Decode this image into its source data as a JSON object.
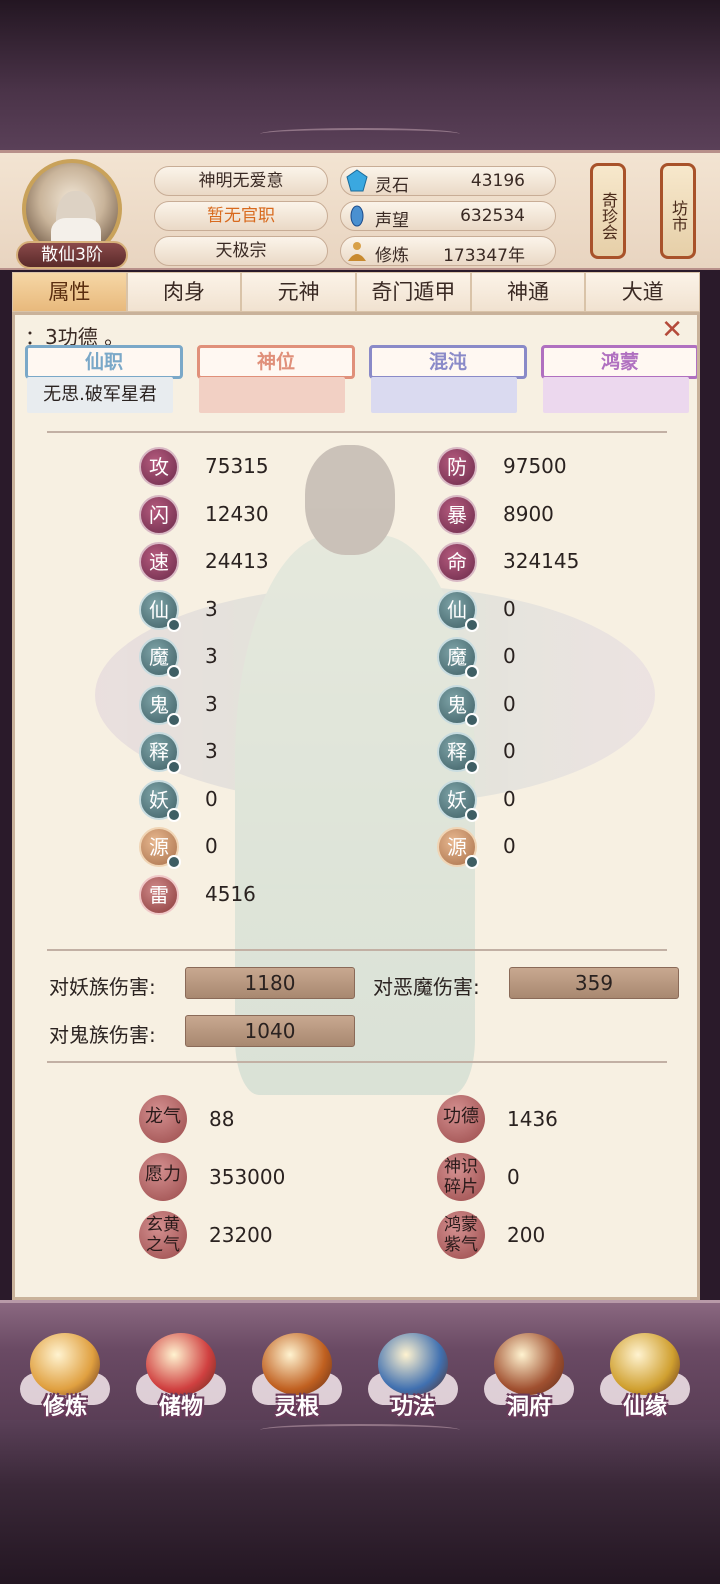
{
  "header": {
    "rank_badge": "散仙3阶",
    "name": "神明无爱意",
    "official_post": "暂无官职",
    "sect": "天极宗",
    "resources": [
      {
        "icon": "spirit-stone-icon",
        "label": "灵石",
        "value": "43196"
      },
      {
        "icon": "reputation-icon",
        "label": "声望",
        "value": "632534"
      },
      {
        "icon": "cultivation-icon",
        "label": "修炼",
        "value": "173347年"
      }
    ],
    "treasure_fair": "奇珍会",
    "market": "坊市"
  },
  "tabs": [
    "属性",
    "肉身",
    "元神",
    "奇门遁甲",
    "神通",
    "大道"
  ],
  "notice": "：3功德 。",
  "ribbons": [
    {
      "label": "仙职",
      "value": "无思.破军星君",
      "color": "#7aa8c8"
    },
    {
      "label": "神位",
      "value": "",
      "color": "#e0907a"
    },
    {
      "label": "混沌",
      "value": "",
      "color": "#8a8ac8"
    },
    {
      "label": "鸿蒙",
      "value": "",
      "color": "#b070c0"
    }
  ],
  "stats_left": [
    {
      "char": "攻",
      "value": "75315",
      "style": "purple",
      "badge": false
    },
    {
      "char": "闪",
      "value": "12430",
      "style": "purple",
      "badge": false
    },
    {
      "char": "速",
      "value": "24413",
      "style": "purple",
      "badge": false
    },
    {
      "char": "仙",
      "value": "3",
      "style": "teal",
      "badge": true
    },
    {
      "char": "魔",
      "value": "3",
      "style": "teal",
      "badge": true
    },
    {
      "char": "鬼",
      "value": "3",
      "style": "teal",
      "badge": true
    },
    {
      "char": "释",
      "value": "3",
      "style": "teal",
      "badge": true
    },
    {
      "char": "妖",
      "value": "0",
      "style": "teal",
      "badge": true
    },
    {
      "char": "源",
      "value": "0",
      "style": "gold",
      "badge": true
    },
    {
      "char": "雷",
      "value": "4516",
      "style": "red",
      "badge": false
    }
  ],
  "stats_right": [
    {
      "char": "防",
      "value": "97500",
      "style": "purple",
      "badge": false
    },
    {
      "char": "暴",
      "value": "8900",
      "style": "purple",
      "badge": false
    },
    {
      "char": "命",
      "value": "324145",
      "style": "purple",
      "badge": false
    },
    {
      "char": "仙",
      "value": "0",
      "style": "teal",
      "badge": true
    },
    {
      "char": "魔",
      "value": "0",
      "style": "teal",
      "badge": true
    },
    {
      "char": "鬼",
      "value": "0",
      "style": "teal",
      "badge": true
    },
    {
      "char": "释",
      "value": "0",
      "style": "teal",
      "badge": true
    },
    {
      "char": "妖",
      "value": "0",
      "style": "teal",
      "badge": true
    },
    {
      "char": "源",
      "value": "0",
      "style": "gold",
      "badge": true
    }
  ],
  "damage": {
    "yao_label": "对妖族伤害:",
    "yao_value": "1180",
    "demon_label": "对恶魔伤害:",
    "demon_value": "359",
    "ghost_label": "对鬼族伤害:",
    "ghost_value": "1040"
  },
  "extra": [
    {
      "label": "龙气",
      "value": "88",
      "two_line": false
    },
    {
      "label": "功德",
      "value": "1436",
      "two_line": false
    },
    {
      "label": "愿力",
      "value": "353000",
      "two_line": false
    },
    {
      "label": "神识碎片",
      "line1": "神识",
      "line2": "碎片",
      "value": "0",
      "two_line": true
    },
    {
      "label": "玄黄之气",
      "line1": "玄黄",
      "line2": "之气",
      "value": "23200",
      "two_line": true
    },
    {
      "label": "鸿蒙紫气",
      "line1": "鸿蒙",
      "line2": "紫气",
      "value": "200",
      "two_line": true
    }
  ],
  "nav": [
    {
      "label": "修炼",
      "icon": "meditating-monk-icon",
      "color": "#e0a040"
    },
    {
      "label": "储物",
      "icon": "storage-bag-icon",
      "color": "#d04040"
    },
    {
      "label": "灵根",
      "icon": "spirit-root-icon",
      "color": "#c06020"
    },
    {
      "label": "功法",
      "icon": "technique-book-icon",
      "color": "#4070b0"
    },
    {
      "label": "洞府",
      "icon": "cave-mansion-icon",
      "color": "#a05030"
    },
    {
      "label": "仙缘",
      "icon": "gourd-icon",
      "color": "#d0a030"
    }
  ]
}
